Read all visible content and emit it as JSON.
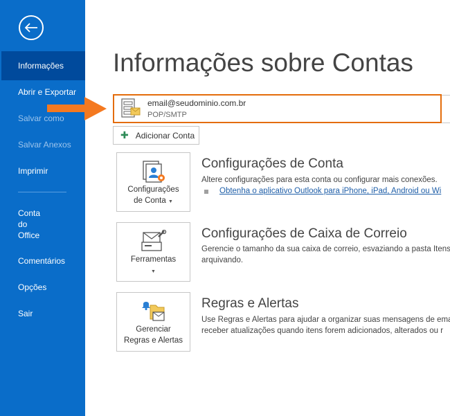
{
  "sidebar": {
    "back_icon": "back-arrow-icon",
    "items": [
      {
        "label": "Informações",
        "state": "active"
      },
      {
        "label": "Abrir e Exportar",
        "state": "normal"
      },
      {
        "label": "Salvar como",
        "state": "disabled"
      },
      {
        "label": "Salvar Anexos",
        "state": "disabled"
      },
      {
        "label": "Imprimir",
        "state": "normal"
      },
      {
        "label": "Conta\ndo\nOffice",
        "state": "normal"
      },
      {
        "label": "Comentários",
        "state": "normal"
      },
      {
        "label": "Opções",
        "state": "normal"
      },
      {
        "label": "Sair",
        "state": "normal"
      }
    ]
  },
  "main": {
    "title": "Informações sobre Contas",
    "account": {
      "email": "email@seudominio.com.br",
      "type": "POP/SMTP",
      "highlight_color": "#e46c0a"
    },
    "add_account_label": "Adicionar Conta",
    "sections": [
      {
        "tile_label_line1": "Configurações",
        "tile_label_line2": "de Conta",
        "title": "Configurações de Conta",
        "desc_line1": "Altere configurações para esta conta ou configurar mais conexões.",
        "link": "Obtenha o aplicativo Outlook para iPhone, iPad, Android ou Wi"
      },
      {
        "tile_label_line1": "Ferramentas",
        "title": "Configurações de Caixa de Correio",
        "desc_line1": "Gerencie o tamanho da sua caixa de correio, esvaziando a pasta Itens",
        "desc_line2": "arquivando."
      },
      {
        "tile_label_line1": "Gerenciar",
        "tile_label_line2": "Regras e Alertas",
        "title": "Regras e Alertas",
        "desc_line1": "Use Regras e Alertas para ajudar a organizar suas mensagens de ema",
        "desc_line2": "receber atualizações quando itens forem adicionados, alterados ou r"
      }
    ]
  },
  "colors": {
    "sidebar_bg": "#0a6dc9",
    "sidebar_active": "#004a9c",
    "arrow": "#f47920"
  }
}
